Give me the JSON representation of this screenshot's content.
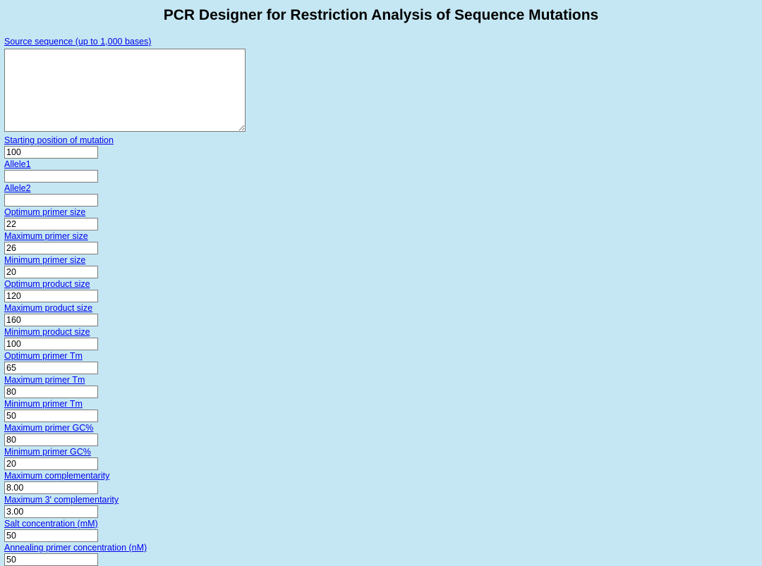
{
  "header": {
    "title": "PCR Designer for Restriction Analysis of Sequence Mutations"
  },
  "fields": {
    "source_seq": {
      "label": "Source sequence (up to 1,000 bases)",
      "value": ""
    },
    "start_pos": {
      "label": "Starting position of mutation",
      "value": "100"
    },
    "allele1": {
      "label": "Allele1",
      "value": ""
    },
    "allele2": {
      "label": "Allele2",
      "value": ""
    },
    "opt_primer_size": {
      "label": "Optimum primer size",
      "value": "22"
    },
    "max_primer_size": {
      "label": "Maximum primer size",
      "value": "26"
    },
    "min_primer_size": {
      "label": "Minimum primer size",
      "value": "20"
    },
    "opt_product_size": {
      "label": "Optimum product size",
      "value": "120"
    },
    "max_product_size": {
      "label": "Maximum product size",
      "value": "160"
    },
    "min_product_size": {
      "label": "Minimum product size",
      "value": "100"
    },
    "opt_primer_tm": {
      "label": "Optimum primer Tm",
      "value": "65"
    },
    "max_primer_tm": {
      "label": "Maximum primer Tm",
      "value": "80"
    },
    "min_primer_tm": {
      "label": "Minimum primer Tm",
      "value": "50"
    },
    "max_primer_gc": {
      "label": "Maximum primer GC%",
      "value": "80"
    },
    "min_primer_gc": {
      "label": "Minimum primer GC%",
      "value": "20"
    },
    "max_complement": {
      "label": "Maximum complementarity",
      "value": "8.00"
    },
    "max_3_complement": {
      "label": "Maximum 3' complementarity",
      "value": "3.00"
    },
    "salt_conc": {
      "label": "Salt concentration (mM)",
      "value": "50"
    },
    "annealing_conc": {
      "label": "Annealing primer concentration (nM)",
      "value": "50"
    }
  }
}
